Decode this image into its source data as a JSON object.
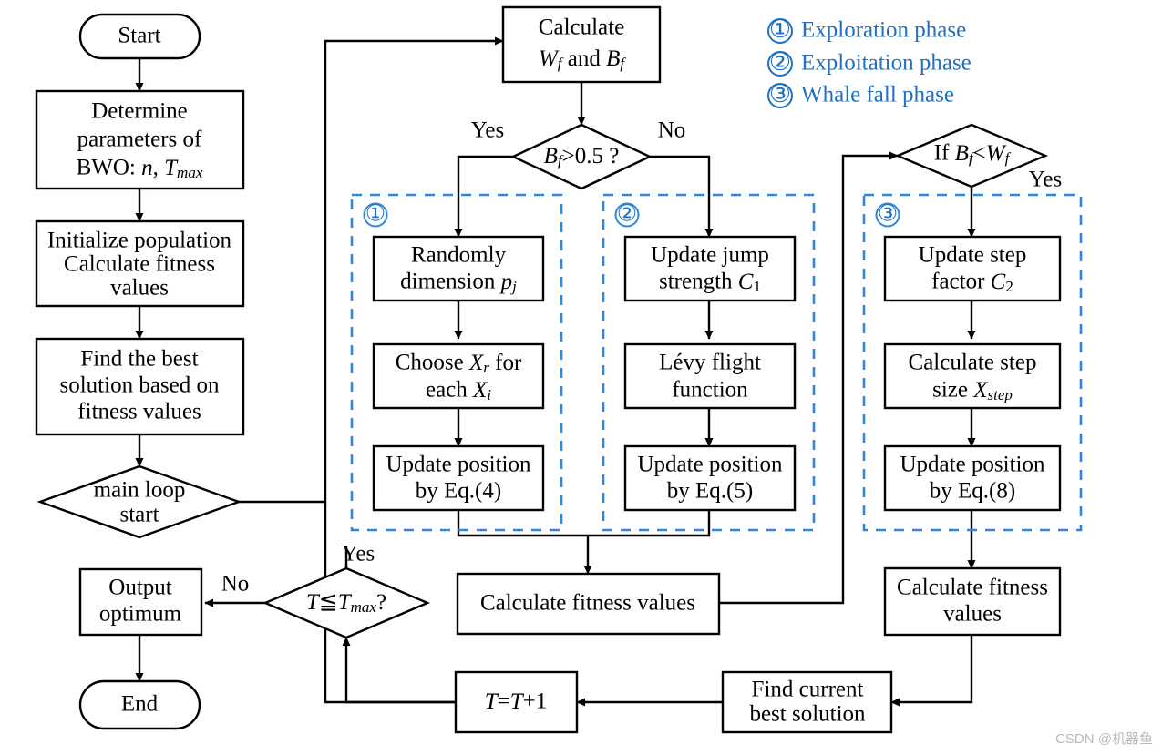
{
  "diagram": {
    "title": "BWO (Beluga Whale Optimization) algorithm flowchart",
    "accent_color": "#2E86DE",
    "legend_text_color": "#1F6FC4",
    "line_color": "#000000",
    "background": "#ffffff"
  },
  "legend": {
    "items": [
      {
        "marker": "①",
        "label": "Exploration phase"
      },
      {
        "marker": "②",
        "label": "Exploitation phase"
      },
      {
        "marker": "③",
        "label": "Whale fall phase"
      }
    ]
  },
  "nodes": {
    "start": {
      "kind": "terminator",
      "lines": [
        "Start"
      ]
    },
    "determine": {
      "kind": "process",
      "lines": [
        "Determine",
        "parameters of",
        "BWO: n, T"
      ],
      "sub_last": "max",
      "italic_tokens": [
        "n",
        "T"
      ]
    },
    "init": {
      "kind": "process",
      "lines": [
        "Initialize population",
        "Calculate fitness",
        "values"
      ]
    },
    "findbest": {
      "kind": "process",
      "lines": [
        "Find the best",
        "solution based on",
        "fitness values"
      ]
    },
    "mainloop": {
      "kind": "decision",
      "lines": [
        "main loop",
        "start"
      ]
    },
    "output": {
      "kind": "process",
      "lines": [
        "Output",
        "optimum"
      ]
    },
    "end": {
      "kind": "terminator",
      "lines": [
        "End"
      ]
    },
    "calcWB": {
      "kind": "process",
      "lines": [
        "Calculate",
        "W_f and B_f"
      ]
    },
    "bfdecision": {
      "kind": "decision",
      "lines": [
        "B_f>0.5 ?"
      ]
    },
    "p1_box1": {
      "kind": "process",
      "lines": [
        "Randomly",
        "dimension p_j"
      ]
    },
    "p1_box2": {
      "kind": "process",
      "lines": [
        "Choose X_r for",
        "each X_i"
      ]
    },
    "p1_box3": {
      "kind": "process",
      "lines": [
        "Update position",
        "by Eq.(4)"
      ]
    },
    "p2_box1": {
      "kind": "process",
      "lines": [
        "Update jump",
        "strength C_1"
      ]
    },
    "p2_box2": {
      "kind": "process",
      "lines": [
        "Lévy flight",
        "function"
      ]
    },
    "p2_box3": {
      "kind": "process",
      "lines": [
        "Update position",
        "by Eq.(5)"
      ]
    },
    "ifBfWf": {
      "kind": "decision",
      "lines": [
        "If B_f<W_f"
      ]
    },
    "p3_box1": {
      "kind": "process",
      "lines": [
        "Update step",
        "factor C_2"
      ]
    },
    "p3_box2": {
      "kind": "process",
      "lines": [
        "Calculate step",
        "size X_step"
      ]
    },
    "p3_box3": {
      "kind": "process",
      "lines": [
        "Update position",
        "by Eq.(8)"
      ]
    },
    "calcfit_mid": {
      "kind": "process",
      "lines": [
        "Calculate fitness values"
      ]
    },
    "calcfit_right": {
      "kind": "process",
      "lines": [
        "Calculate fitness",
        "values"
      ]
    },
    "findcurrent": {
      "kind": "process",
      "lines": [
        "Find current",
        "best solution"
      ]
    },
    "tincr": {
      "kind": "process",
      "lines": [
        "T=T+1"
      ]
    },
    "tmaxdecision": {
      "kind": "decision",
      "lines": [
        "T≤T_max?"
      ]
    }
  },
  "edge_labels": {
    "yes_bf": "Yes",
    "no_bf": "No",
    "yes_ifbf": "Yes",
    "yes_tmax": "Yes",
    "no_tmax": "No"
  },
  "phase_markers": {
    "phase1": "①",
    "phase2": "②",
    "phase3": "③"
  },
  "watermark": {
    "text": "CSDN @机器鱼"
  }
}
